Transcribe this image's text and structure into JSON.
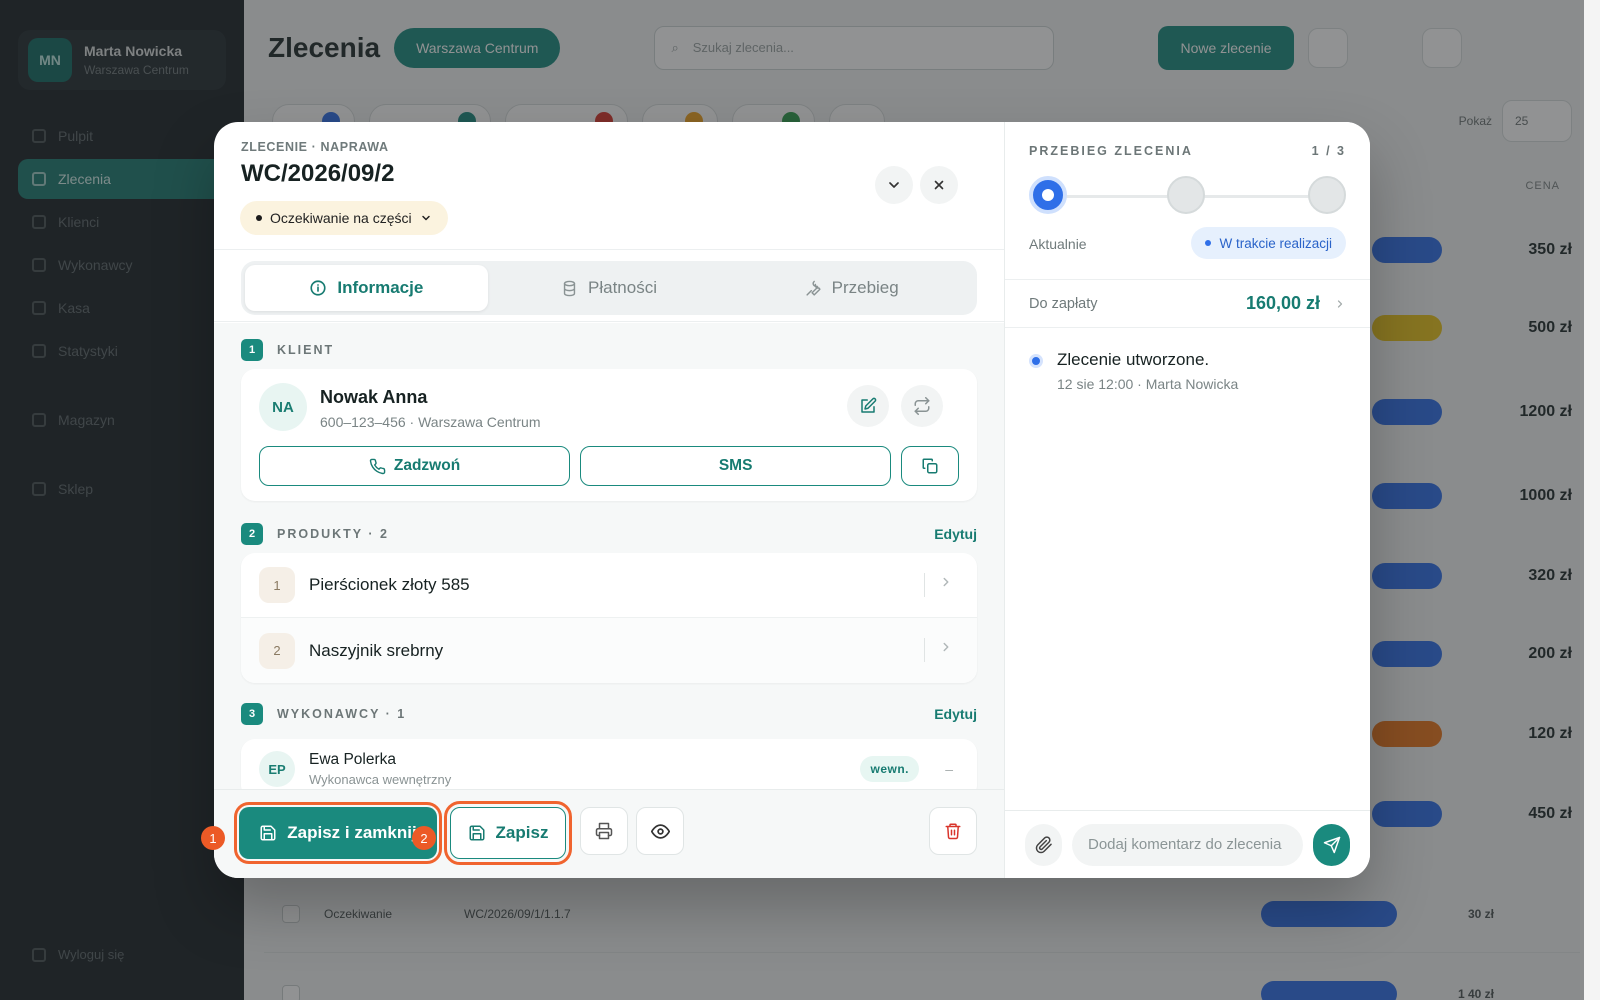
{
  "background": {
    "user": {
      "initials": "MN",
      "name": "Marta Nowicka",
      "location": "Warszawa Centrum"
    },
    "nav": [
      "Pulpit",
      "Zlecenia",
      "Klienci",
      "Wykonawcy",
      "Kasa",
      "Statystyki",
      "Magazyn",
      "Sklep"
    ],
    "logout": "Wyloguj się",
    "page_title": "Zlecenia",
    "branch": "Warszawa Centrum",
    "search_placeholder": "Szukaj zlecenia...",
    "new_order": "Nowe zlecenie",
    "per_page_label": "Pokaż",
    "per_page": "25",
    "col_amount": "CENA",
    "amounts": [
      "350 zł",
      "500 zł",
      "1200 zł",
      "1000 zł",
      "320 zł",
      "200 zł",
      "120 zł",
      "450 zł",
      "30 zł",
      "1 40 zł"
    ],
    "row_order": "Oczekiwanie",
    "row_number": "WC/2026/09/1/1.1.7"
  },
  "modal": {
    "eyebrow": "ZLECENIE · NAPRAWA",
    "order_number": "WC/2026/09/2",
    "status": "Oczekiwanie na części",
    "tabs": [
      {
        "label": "Informacje",
        "icon": "info-icon"
      },
      {
        "label": "Płatności",
        "icon": "database-icon"
      },
      {
        "label": "Przebieg",
        "icon": "wrench-icon"
      }
    ],
    "client": {
      "section_no": "1",
      "section_title": "KLIENT",
      "initials": "NA",
      "name": "Nowak Anna",
      "meta": "600–123–456 · Warszawa Centrum",
      "call_label": "Zadzwoń",
      "sms_label": "SMS"
    },
    "products": {
      "section_no": "2",
      "section_title": "PRODUKTY · 2",
      "edit_label": "Edytuj",
      "items": [
        {
          "no": "1",
          "name": "Pierścionek złoty 585"
        },
        {
          "no": "2",
          "name": "Naszyjnik srebrny"
        }
      ]
    },
    "workers": {
      "section_no": "3",
      "section_title": "WYKONAWCY · 1",
      "edit_label": "Edytuj",
      "items": [
        {
          "initials": "EP",
          "name": "Ewa Polerka",
          "role": "Wykonawca wewnętrzny",
          "tag": "wewn.",
          "extra": "–"
        }
      ]
    },
    "footer": {
      "save_close_label": "Zapisz i zamknij",
      "save_label": "Zapisz",
      "marker_1": "1",
      "marker_2": "2"
    }
  },
  "timeline": {
    "title": "PRZEBIEG ZLECENIA",
    "step_counter": "1 / 3",
    "current_step": 1,
    "total_steps": 3,
    "now_label": "Aktualnie",
    "now_status": "W trakcie realizacji",
    "pay_label": "Do zapłaty",
    "pay_value": "160,00 zł",
    "events": [
      {
        "title": "Zlecenie utworzone.",
        "meta": "12 sie 12:00 · Marta Nowicka"
      }
    ],
    "comment_placeholder": "Dodaj komentarz do zlecenia"
  },
  "colors": {
    "brand": "#1a8a7e",
    "highlight": "#f0642f",
    "accent_blue": "#2f6fe8",
    "status_amber": "#fbf3df"
  }
}
